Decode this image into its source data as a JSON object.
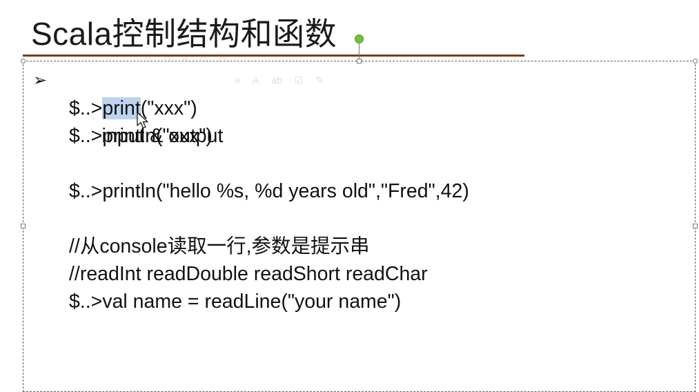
{
  "slide": {
    "title": "Scala控制结构和函数"
  },
  "mini_toolbar": {
    "row1": [
      "A",
      "A",
      "a",
      "A",
      "A"
    ],
    "row2": [
      "≡",
      "A",
      "ab",
      "☑",
      "✎"
    ]
  },
  "content": {
    "bullet": "➢",
    "heading": "input & output",
    "line_print": {
      "prefix": "$..>",
      "selected": "print",
      "suffix": "(\"xxx\")"
    },
    "line_println": "$..>println(\"xxx\")",
    "line_format": "$..>println(\"hello %s, %d years old\",\"Fred\",42)",
    "comment_readline": "//从console读取一行,参数是提示串",
    "comment_reads": "//readInt readDouble readShort readChar",
    "line_readline": "$..>val name = readLine(\"your name\")"
  }
}
